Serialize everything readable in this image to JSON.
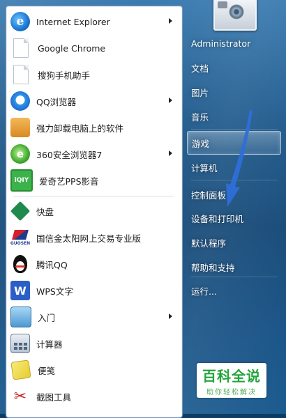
{
  "programs": [
    {
      "label": "Internet Explorer",
      "icon": "internet-explorer-icon",
      "has_submenu": true
    },
    {
      "label": "Google Chrome",
      "icon": "blank-document-icon",
      "has_submenu": false
    },
    {
      "label": "搜狗手机助手",
      "icon": "blank-document-icon",
      "has_submenu": false
    },
    {
      "label": "QQ浏览器",
      "icon": "qq-browser-icon",
      "has_submenu": true
    },
    {
      "label": "强力卸载电脑上的软件",
      "icon": "uninstall-icon",
      "has_submenu": false
    },
    {
      "label": "360安全浏览器7",
      "icon": "360-browser-icon",
      "has_submenu": true
    },
    {
      "label": "爱奇艺PPS影音",
      "icon": "iqiyi-icon",
      "has_submenu": false
    },
    {
      "label": "快盘",
      "icon": "kuaipan-icon",
      "has_submenu": false
    },
    {
      "label": "国信金太阳网上交易专业版",
      "icon": "guosen-icon",
      "has_submenu": false
    },
    {
      "label": "腾讯QQ",
      "icon": "qq-penguin-icon",
      "has_submenu": false
    },
    {
      "label": "WPS文字",
      "icon": "wps-icon",
      "has_submenu": false
    },
    {
      "label": "入门",
      "icon": "getting-started-icon",
      "has_submenu": true
    },
    {
      "label": "计算器",
      "icon": "calculator-icon",
      "has_submenu": false
    },
    {
      "label": "便笺",
      "icon": "sticky-notes-icon",
      "has_submenu": false
    },
    {
      "label": "截图工具",
      "icon": "snipping-tool-icon",
      "has_submenu": false
    }
  ],
  "guosen_icon_text": "GUOSEN",
  "wps_icon_letter": "W",
  "right_pane": {
    "user": "Administrator",
    "items": [
      {
        "label": "文档"
      },
      {
        "label": "图片"
      },
      {
        "label": "音乐"
      },
      {
        "label": "游戏",
        "highlighted": true
      },
      {
        "label": "计算机"
      },
      {
        "label": "控制面板"
      },
      {
        "label": "设备和打印机"
      },
      {
        "label": "默认程序"
      },
      {
        "label": "帮助和支持"
      },
      {
        "label": "运行..."
      }
    ]
  },
  "watermark": {
    "title": "百科全说",
    "subtitle": "助你轻松解决"
  },
  "colors": {
    "accent_arrow": "#2e6fd8",
    "watermark_green": "#22a43b"
  }
}
